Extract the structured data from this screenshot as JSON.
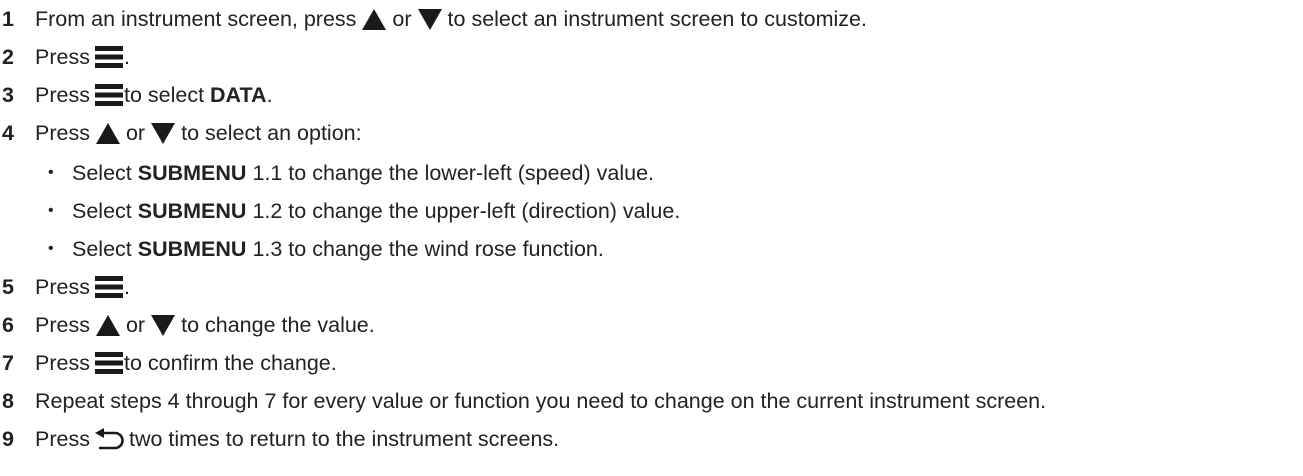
{
  "steps": [
    {
      "num": "1",
      "t1": "From an instrument screen, press",
      "t2": "or",
      "t3": "to select an instrument screen to customize."
    },
    {
      "num": "2",
      "t1": "Press",
      "t2": "."
    },
    {
      "num": "3",
      "t1": "Press",
      "t2": "to select",
      "b1": "DATA",
      "t3": "."
    },
    {
      "num": "4",
      "t1": "Press",
      "t2": "or",
      "t3": "to select an option:"
    },
    {
      "num": "5",
      "t1": "Press",
      "t2": "."
    },
    {
      "num": "6",
      "t1": "Press",
      "t2": "or",
      "t3": "to change the value."
    },
    {
      "num": "7",
      "t1": "Press",
      "t2": "to confirm the change."
    },
    {
      "num": "8",
      "t1": "Repeat steps 4 through 7 for every value or function you need to change on the current instrument screen."
    },
    {
      "num": "9",
      "t1": "Press",
      "t2": "two times to return to the instrument screens."
    }
  ],
  "suboptions": [
    {
      "bullet": "•",
      "t1": "Select",
      "b1": "SUBMENU",
      "t2": "1.1 to change the lower-left (speed) value."
    },
    {
      "bullet": "•",
      "t1": "Select",
      "b1": "SUBMENU",
      "t2": "1.2 to change the upper-left (direction) value."
    },
    {
      "bullet": "•",
      "t1": "Select",
      "b1": "SUBMENU",
      "t2": "1.3 to change the wind rose function."
    }
  ],
  "icons": {
    "up": "up-arrow-icon",
    "down": "down-arrow-icon",
    "menu": "menu-icon",
    "back": "back-icon"
  },
  "colors": {
    "text": "#222222",
    "icon": "#1a1a1a"
  }
}
